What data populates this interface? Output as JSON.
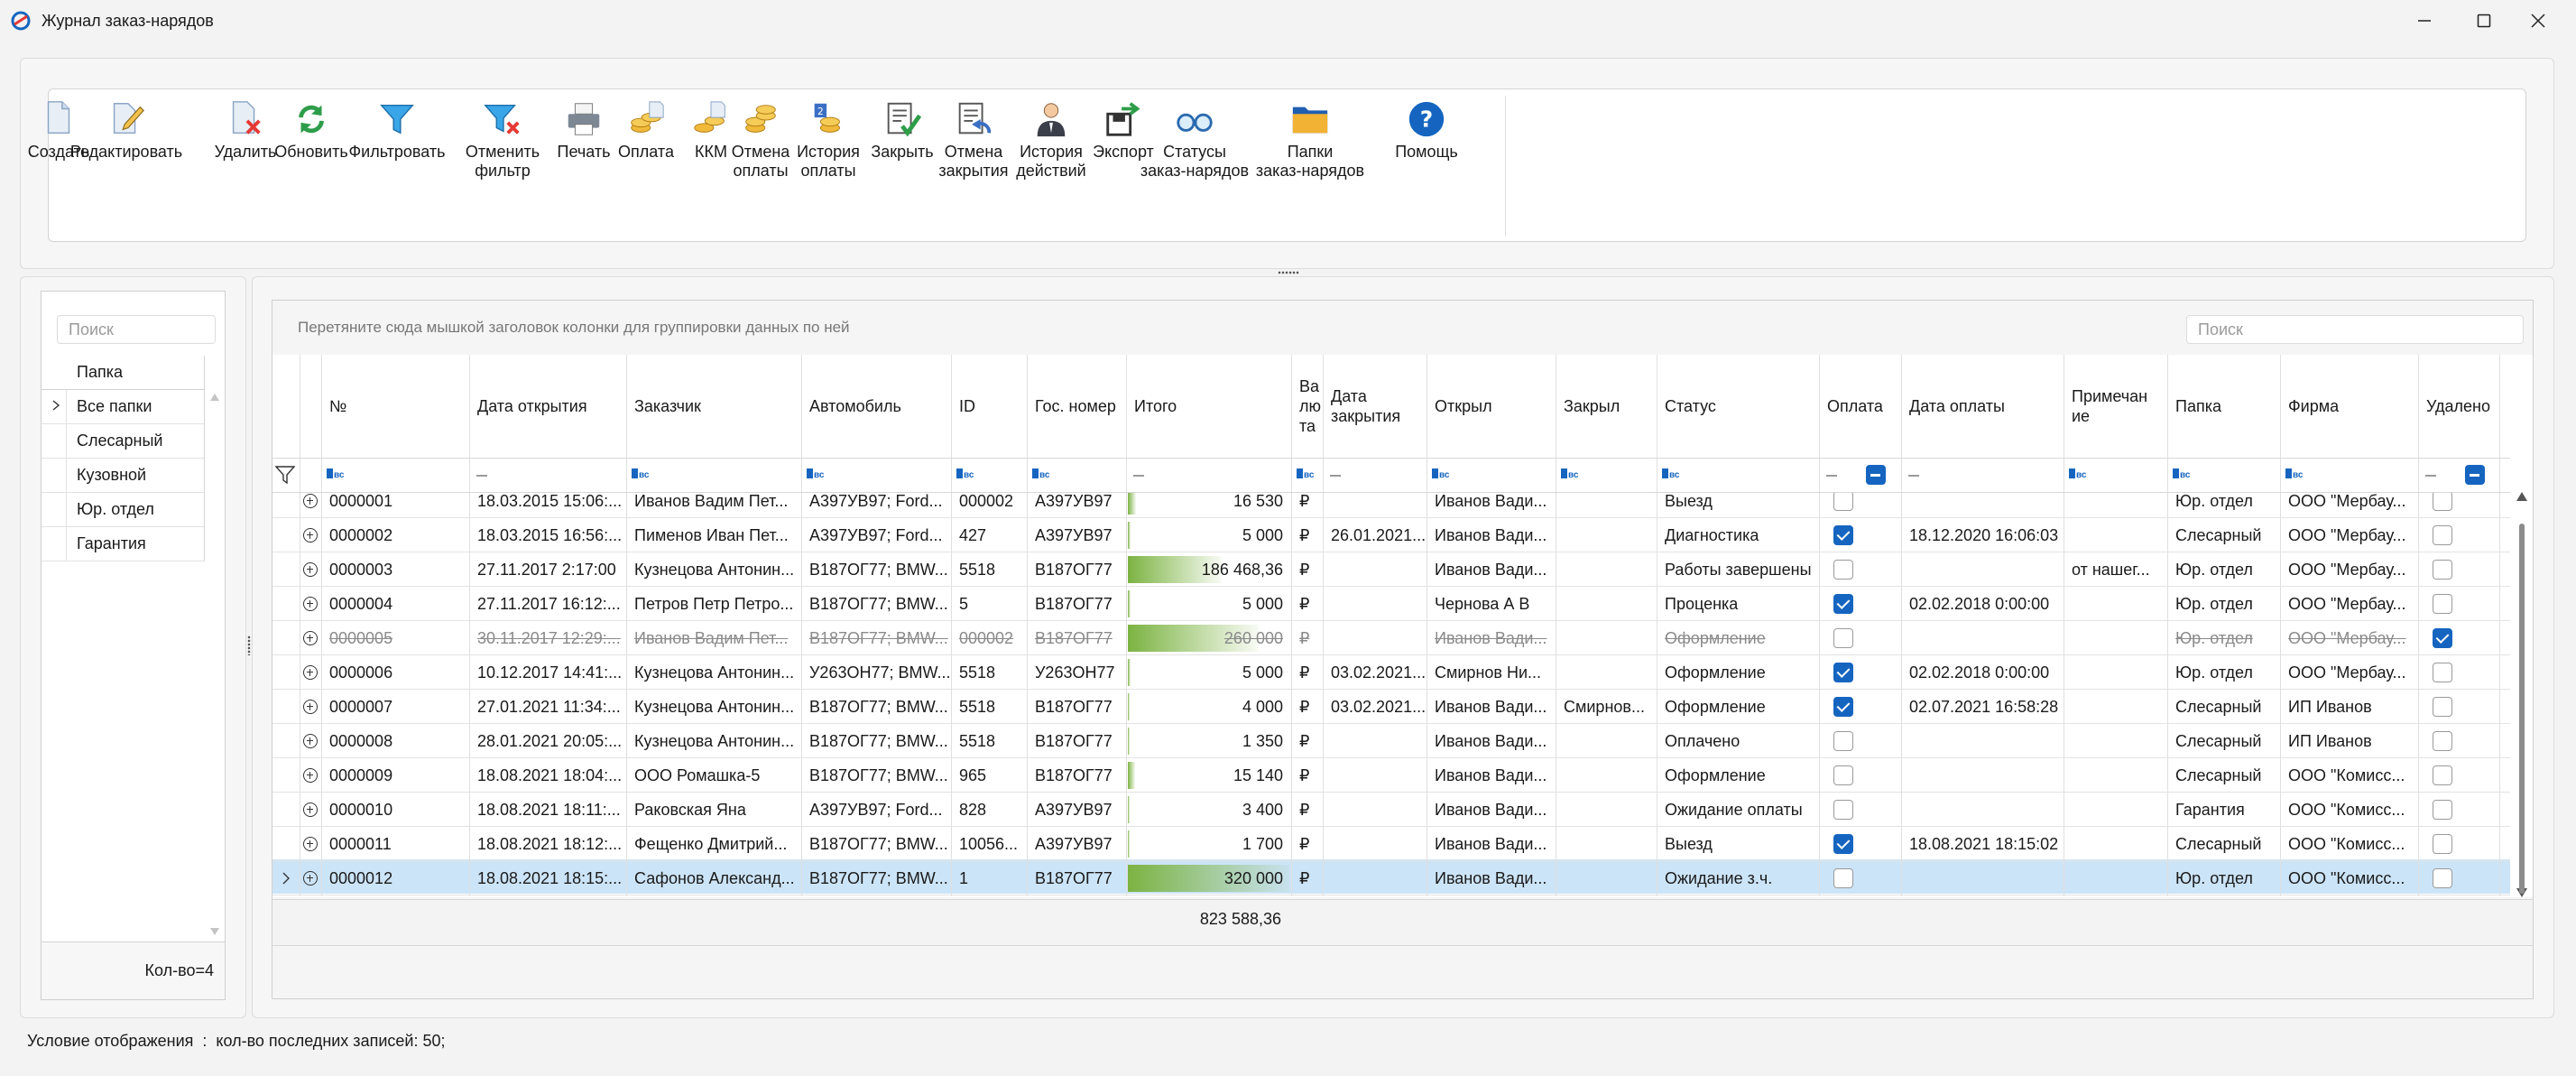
{
  "window": {
    "title": "Журнал заказ-нарядов"
  },
  "toolbar": {
    "buttons": [
      {
        "label": "Создать",
        "icon": "document-icon"
      },
      {
        "label": "Редактировать",
        "icon": "edit-document-icon"
      },
      {
        "label": "Удалить",
        "icon": "delete-document-icon"
      },
      {
        "label": "Обновить",
        "icon": "refresh-icon"
      },
      {
        "label": "Фильтровать",
        "icon": "filter-icon"
      },
      {
        "label": "Отменить\nфильтр",
        "icon": "clear-filter-icon"
      },
      {
        "label": "Печать",
        "icon": "printer-icon"
      },
      {
        "label": "Оплата",
        "icon": "coins-icon"
      },
      {
        "label": "ККМ",
        "icon": "cash-register-icon"
      },
      {
        "label": "Отмена\nоплаты",
        "icon": "cancel-payment-icon"
      },
      {
        "label": "История\nоплаты",
        "icon": "payment-history-icon"
      },
      {
        "label": "Закрыть",
        "icon": "close-order-icon"
      },
      {
        "label": "Отмена\nзакрытия",
        "icon": "undo-close-icon"
      },
      {
        "label": "История\nдействий",
        "icon": "user-history-icon"
      },
      {
        "label": "Экспорт",
        "icon": "export-icon"
      },
      {
        "label": "Статусы\nзаказ-нарядов",
        "icon": "glasses-icon"
      },
      {
        "label": "Папки\nзаказ-нарядов",
        "icon": "folders-icon"
      },
      {
        "label": "Помощь",
        "icon": "help-icon"
      }
    ]
  },
  "folders": {
    "search_placeholder": "Поиск",
    "header": "Папка",
    "items": [
      "Все папки",
      "Слесарный",
      "Кузовной",
      "Юр. отдел",
      "Гарантия"
    ],
    "count_label": "Кол-во=4"
  },
  "grid": {
    "group_hint": "Перетяните сюда мышкой заголовок колонки для группировки данных по ней",
    "search_placeholder": "Поиск",
    "columns": [
      "№",
      "Дата открытия",
      "Заказчик",
      "Автомобиль",
      "ID",
      "Гос. номер",
      "Итого",
      "Ва\nлю\nта",
      "Дата\nзакрытия",
      "Открыл",
      "Закрыл",
      "Статус",
      "Оплата",
      "Дата оплаты",
      "Примечан\nие",
      "Папка",
      "Фирма",
      "Удалено"
    ],
    "filter_badge": "вс",
    "rows": [
      {
        "num": "0000001",
        "opened": "18.03.2015 15:06:...",
        "customer": "Иванов Вадим Пет...",
        "car": "А397УВ97; Ford...",
        "id": "000002",
        "plate": "А397УВ97",
        "total": "16 530",
        "total_value": 16530,
        "cur": "₽",
        "closed": "",
        "opened_by": "Иванов Вади...",
        "closed_by": "",
        "status": "Выезд",
        "paid": false,
        "pay_date": "",
        "note": "",
        "folder": "Юр. отдел",
        "firm": "ООО \"Мербау...",
        "deleted": false
      },
      {
        "num": "0000002",
        "opened": "18.03.2015 16:56:...",
        "customer": "Пименов Иван Пет...",
        "car": "А397УВ97; Ford...",
        "id": "427",
        "plate": "А397УВ97",
        "total": "5 000",
        "total_value": 5000,
        "cur": "₽",
        "closed": "26.01.2021...",
        "opened_by": "Иванов Вади...",
        "closed_by": "",
        "status": "Диагностика",
        "paid": true,
        "pay_date": "18.12.2020 16:06:03",
        "note": "",
        "folder": "Слесарный",
        "firm": "ООО \"Мербау...",
        "deleted": false
      },
      {
        "num": "0000003",
        "opened": "27.11.2017 2:17:00",
        "customer": "Кузнецова Антонин...",
        "car": "В187ОГ77; BMW...",
        "id": "5518",
        "plate": "В187ОГ77",
        "total": "186 468,36",
        "total_value": 186468.36,
        "cur": "₽",
        "closed": "",
        "opened_by": "Иванов Вади...",
        "closed_by": "",
        "status": "Работы завершены",
        "paid": false,
        "pay_date": "",
        "note": "от нашег...",
        "folder": "Юр. отдел",
        "firm": "ООО \"Мербау...",
        "deleted": false
      },
      {
        "num": "0000004",
        "opened": "27.11.2017 16:12:...",
        "customer": "Петров Петр Петро...",
        "car": "В187ОГ77; BMW...",
        "id": "5",
        "plate": "В187ОГ77",
        "total": "5 000",
        "total_value": 5000,
        "cur": "₽",
        "closed": "",
        "opened_by": "Чернова А В",
        "closed_by": "",
        "status": "Проценка",
        "paid": true,
        "pay_date": "02.02.2018 0:00:00",
        "note": "",
        "folder": "Юр. отдел",
        "firm": "ООО \"Мербау...",
        "deleted": false
      },
      {
        "num": "0000005",
        "opened": "30.11.2017 12:29:...",
        "customer": "Иванов Вадим Пет...",
        "car": "В187ОГ77; BMW...",
        "id": "000002",
        "plate": "В187ОГ77",
        "total": "260 000",
        "total_value": 260000,
        "cur": "₽",
        "closed": "",
        "opened_by": "Иванов Вади...",
        "closed_by": "",
        "status": "Оформление",
        "paid": false,
        "pay_date": "",
        "note": "",
        "folder": "Юр. отдел",
        "firm": "ООО \"Мербау...",
        "deleted": true
      },
      {
        "num": "0000006",
        "opened": "10.12.2017 14:41:...",
        "customer": "Кузнецова Антонин...",
        "car": "У263ОН77; BMW...",
        "id": "5518",
        "plate": "У263ОН77",
        "total": "5 000",
        "total_value": 5000,
        "cur": "₽",
        "closed": "03.02.2021...",
        "opened_by": "Смирнов Ни...",
        "closed_by": "",
        "status": "Оформление",
        "paid": true,
        "pay_date": "02.02.2018 0:00:00",
        "note": "",
        "folder": "Юр. отдел",
        "firm": "ООО \"Мербау...",
        "deleted": false
      },
      {
        "num": "0000007",
        "opened": "27.01.2021 11:34:...",
        "customer": "Кузнецова Антонин...",
        "car": "В187ОГ77; BMW...",
        "id": "5518",
        "plate": "В187ОГ77",
        "total": "4 000",
        "total_value": 4000,
        "cur": "₽",
        "closed": "03.02.2021...",
        "opened_by": "Иванов Вади...",
        "closed_by": "Смирнов...",
        "status": "Оформление",
        "paid": true,
        "pay_date": "02.07.2021 16:58:28",
        "note": "",
        "folder": "Слесарный",
        "firm": "ИП Иванов",
        "deleted": false
      },
      {
        "num": "0000008",
        "opened": "28.01.2021 20:05:...",
        "customer": "Кузнецова Антонин...",
        "car": "В187ОГ77; BMW...",
        "id": "5518",
        "plate": "В187ОГ77",
        "total": "1 350",
        "total_value": 1350,
        "cur": "₽",
        "closed": "",
        "opened_by": "Иванов Вади...",
        "closed_by": "",
        "status": "Оплачено",
        "paid": false,
        "pay_date": "",
        "note": "",
        "folder": "Слесарный",
        "firm": "ИП Иванов",
        "deleted": false
      },
      {
        "num": "0000009",
        "opened": "18.08.2021 18:04:...",
        "customer": "ООО Ромашка-5",
        "car": "В187ОГ77; BMW...",
        "id": "965",
        "plate": "В187ОГ77",
        "total": "15 140",
        "total_value": 15140,
        "cur": "₽",
        "closed": "",
        "opened_by": "Иванов Вади...",
        "closed_by": "",
        "status": "Оформление",
        "paid": false,
        "pay_date": "",
        "note": "",
        "folder": "Слесарный",
        "firm": "ООО \"Комисс...",
        "deleted": false
      },
      {
        "num": "0000010",
        "opened": "18.08.2021 18:11:...",
        "customer": "Раковская Яна",
        "car": "А397УВ97; Ford...",
        "id": "828",
        "plate": "А397УВ97",
        "total": "3 400",
        "total_value": 3400,
        "cur": "₽",
        "closed": "",
        "opened_by": "Иванов Вади...",
        "closed_by": "",
        "status": "Ожидание оплаты",
        "paid": false,
        "pay_date": "",
        "note": "",
        "folder": "Гарантия",
        "firm": "ООО \"Комисс...",
        "deleted": false
      },
      {
        "num": "0000011",
        "opened": "18.08.2021 18:12:...",
        "customer": "Фещенко Дмитрий...",
        "car": "В187ОГ77; BMW...",
        "id": "10056...",
        "plate": "А397УВ97",
        "total": "1 700",
        "total_value": 1700,
        "cur": "₽",
        "closed": "",
        "opened_by": "Иванов Вади...",
        "closed_by": "",
        "status": "Выезд",
        "paid": true,
        "pay_date": "18.08.2021 18:15:02",
        "note": "",
        "folder": "Слесарный",
        "firm": "ООО \"Комисс...",
        "deleted": false
      },
      {
        "num": "0000012",
        "opened": "18.08.2021 18:15:...",
        "customer": "Сафонов Александ...",
        "car": "В187ОГ77; BMW...",
        "id": "1",
        "plate": "В187ОГ77",
        "total": "320 000",
        "total_value": 320000,
        "cur": "₽",
        "closed": "",
        "opened_by": "Иванов Вади...",
        "closed_by": "",
        "status": "Ожидание з.ч.",
        "paid": false,
        "pay_date": "",
        "note": "",
        "folder": "Юр. отдел",
        "firm": "ООО \"Комисс...",
        "deleted": false
      }
    ],
    "selected_row": 11,
    "total_sum": "823 588,36"
  },
  "status_bar": {
    "text": "Условие отображения  :  кол-во последних записей: 50;"
  },
  "colors": {
    "accent": "#1565c0",
    "selection": "#cce4f7",
    "databar": "#7cb342"
  }
}
